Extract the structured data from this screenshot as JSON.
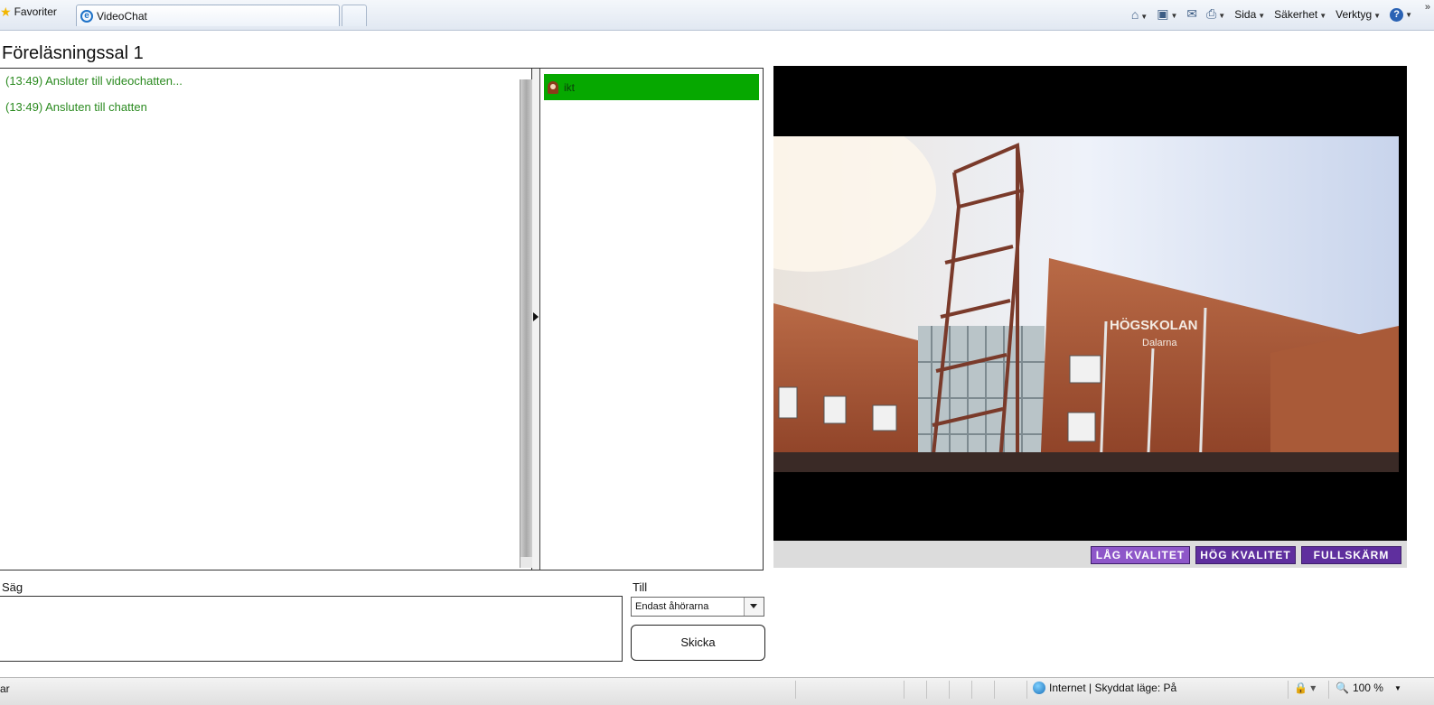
{
  "browser": {
    "favorites_label": "Favoriter",
    "tab_title": "VideoChat",
    "commands": {
      "page": "Sida",
      "safety": "Säkerhet",
      "tools": "Verktyg"
    },
    "chevron": "»"
  },
  "page": {
    "title": "Föreläsningssal 1"
  },
  "chat": {
    "messages": [
      "(13:49) Ansluter till videochatten...",
      "(13:49) Ansluten till chatten"
    ],
    "message_color": "#2a8a1f"
  },
  "users": {
    "items": [
      {
        "name": "ikt",
        "highlight_color": "#06a800"
      }
    ]
  },
  "video": {
    "buttons": {
      "low_quality": "LÅG KVALITET",
      "high_quality": "HÖG KVALITET",
      "fullscreen": "FULLSKÄRM"
    },
    "colors": {
      "low_btn": "#8e57c9",
      "btn": "#5f2f9e"
    },
    "sign_text": "HÖGSKOLAN",
    "sign_subtext": "Dalarna"
  },
  "compose": {
    "say_label": "Säg",
    "say_value": "",
    "to_label": "Till",
    "to_selected": "Endast åhörarna",
    "send_label": "Skicka"
  },
  "statusbar": {
    "left_text": "ar",
    "zone_text": "Internet | Skyddat läge: På",
    "zoom": "100 %"
  }
}
